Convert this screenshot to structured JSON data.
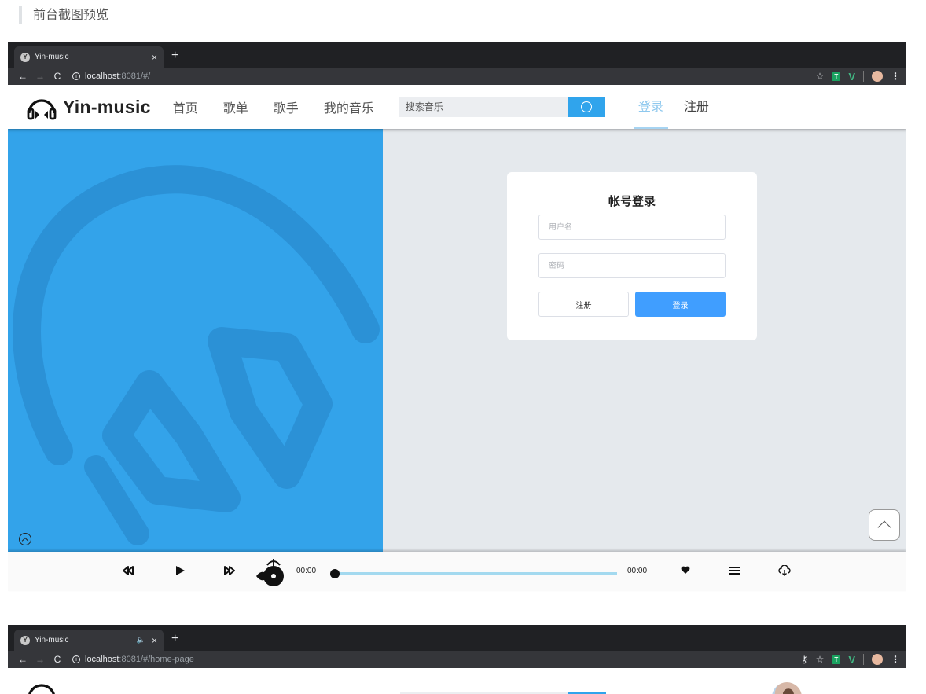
{
  "heading": "前台截图预览",
  "browser1": {
    "tab_title": "Yin-music",
    "tab_close": "×",
    "new_tab": "+",
    "nav": {
      "back": "←",
      "forward": "→",
      "reload": "C"
    },
    "url_host": "localhost",
    "url_path": ":8081/#/",
    "ext": {
      "star": "☆",
      "tampermonkey": "T",
      "vue": "V",
      "menu": "⋮"
    }
  },
  "browser2": {
    "tab_title": "Yin-music",
    "tab_mute": "🔈",
    "tab_close": "×",
    "new_tab": "+",
    "nav": {
      "back": "←",
      "forward": "→",
      "reload": "C"
    },
    "url_host": "localhost",
    "url_path": ":8081/#/home-page",
    "ext": {
      "key": "⚷",
      "star": "☆",
      "tampermonkey": "T",
      "vue": "V",
      "menu": "⋮"
    }
  },
  "app": {
    "logo_text": "Yin-music",
    "nav": [
      "首页",
      "歌单",
      "歌手",
      "我的音乐"
    ],
    "search_placeholder": "搜索音乐",
    "auth": {
      "login": "登录",
      "register": "注册"
    }
  },
  "login_form": {
    "title": "帐号登录",
    "username_placeholder": "用户名",
    "password_placeholder": "密码",
    "register_button": "注册",
    "login_button": "登录"
  },
  "player": {
    "current_time": "00:00",
    "total_time": "00:00",
    "progress": 0
  },
  "colors": {
    "brand_blue": "#33a3ea",
    "login_button": "#409eff",
    "active_tab": "#8ec8ee"
  }
}
